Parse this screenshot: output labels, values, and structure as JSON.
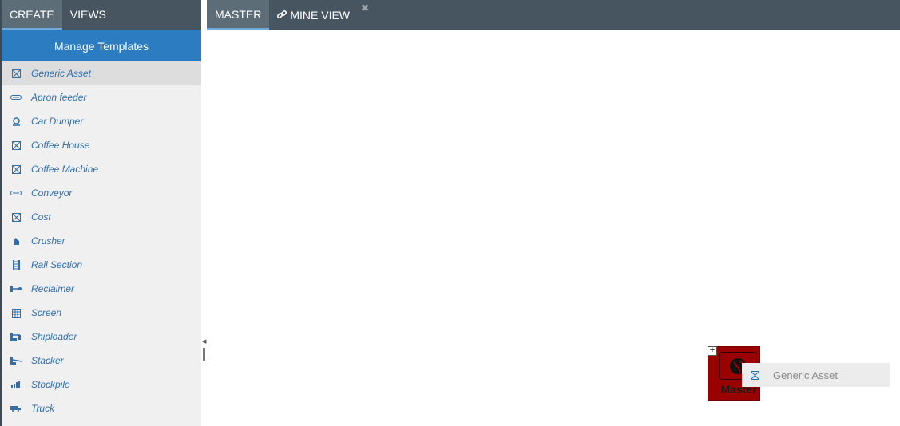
{
  "left_panel": {
    "tabs": [
      {
        "label": "CREATE"
      },
      {
        "label": "VIEWS"
      }
    ],
    "manage_button": "Manage Templates",
    "templates": [
      {
        "label": "Generic Asset",
        "icon": "boxed-x-icon"
      },
      {
        "label": "Apron feeder",
        "icon": "belt-icon"
      },
      {
        "label": "Car Dumper",
        "icon": "dumper-icon"
      },
      {
        "label": "Coffee House",
        "icon": "boxed-x-icon"
      },
      {
        "label": "Coffee Machine",
        "icon": "boxed-x-icon"
      },
      {
        "label": "Conveyor",
        "icon": "belt-icon"
      },
      {
        "label": "Cost",
        "icon": "boxed-x-icon"
      },
      {
        "label": "Crusher",
        "icon": "crusher-icon"
      },
      {
        "label": "Rail Section",
        "icon": "rail-icon"
      },
      {
        "label": "Reclaimer",
        "icon": "reclaimer-icon"
      },
      {
        "label": "Screen",
        "icon": "grid-icon"
      },
      {
        "label": "Shiploader",
        "icon": "shiploader-icon"
      },
      {
        "label": "Stacker",
        "icon": "stacker-icon"
      },
      {
        "label": "Stockpile",
        "icon": "bars-icon"
      },
      {
        "label": "Truck",
        "icon": "truck-icon"
      }
    ]
  },
  "right_panel": {
    "tabs": [
      {
        "label": "MASTER"
      },
      {
        "label": "MINE VIEW",
        "icon": "link-icon"
      }
    ],
    "close_symbol": "✖",
    "node": {
      "label": "Master",
      "expand_symbol": "+",
      "color": "#9b0000",
      "icon": "globe-icon"
    },
    "drag_chip": {
      "label": "Generic Asset",
      "icon": "boxed-x-icon"
    }
  },
  "colors": {
    "tab_bar": "#46555f",
    "manage_button": "#2b7cc1",
    "link_text": "#2f6fae"
  }
}
